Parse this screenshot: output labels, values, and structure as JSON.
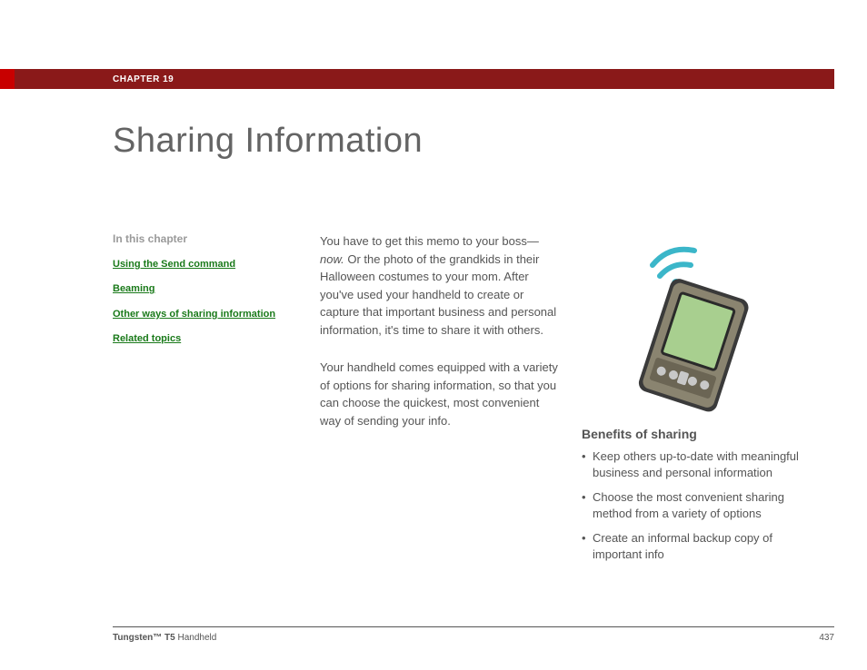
{
  "header": {
    "chapter": "CHAPTER 19"
  },
  "title": "Sharing Information",
  "sidebar": {
    "heading": "In this chapter",
    "links": [
      "Using the Send command",
      "Beaming",
      "Other ways of sharing information",
      "Related topics"
    ]
  },
  "intro": {
    "p1_a": "You have to get this memo to your boss—",
    "p1_em": "now.",
    "p1_b": " Or the photo of the grandkids in their Halloween costumes to your mom. After you've used your handheld to create or capture that important business and personal information, it's time to share it with others.",
    "p2": "Your handheld comes equipped with a variety of options for sharing information, so that you can choose the quickest, most convenient way of sending your info."
  },
  "benefits": {
    "heading": "Benefits of sharing",
    "items": [
      "Keep others up-to-date with meaningful business and personal information",
      "Choose the most convenient sharing method from a variety of options",
      "Create an informal backup copy of important info"
    ]
  },
  "footer": {
    "product_bold": "Tungsten™ T5",
    "product_rest": " Handheld",
    "page": "437"
  }
}
